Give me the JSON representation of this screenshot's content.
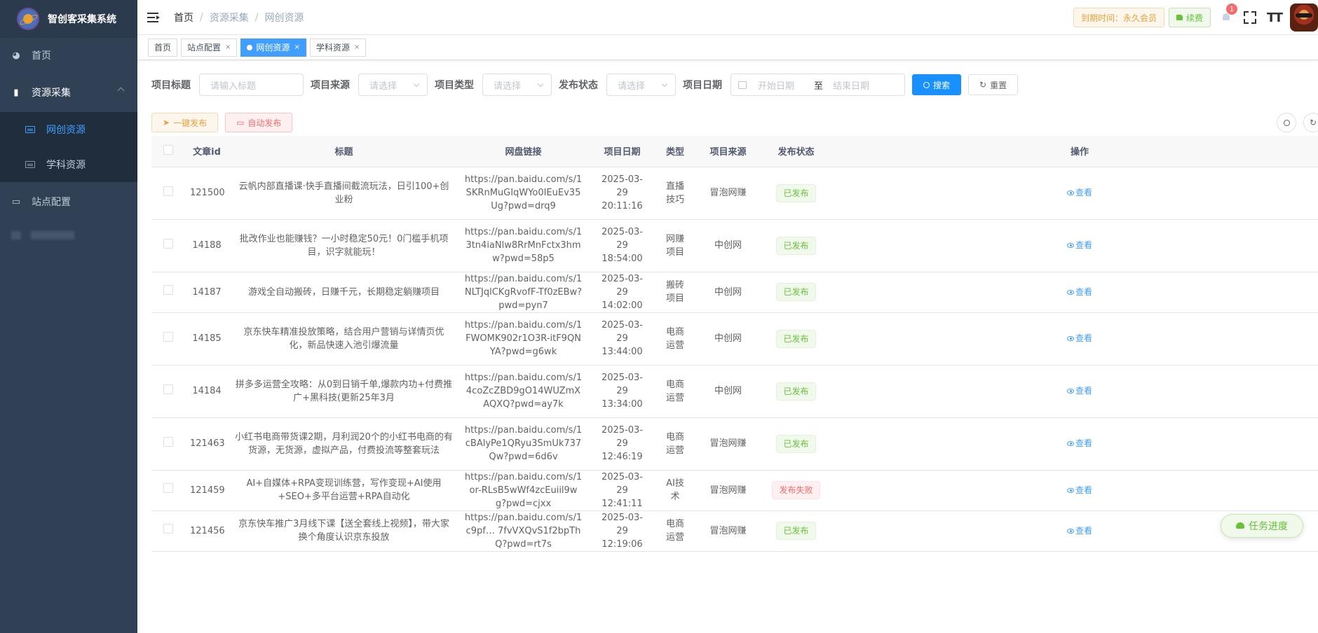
{
  "app": {
    "title": "智创客采集系统"
  },
  "sidebar": {
    "items": [
      {
        "label": "首页",
        "icon": "dashboard-icon"
      },
      {
        "label": "资源采集",
        "icon": "chart-icon"
      },
      {
        "label": "站点配置",
        "icon": "monitor-icon"
      }
    ],
    "sub_items": [
      {
        "label": "网创资源",
        "active": true
      },
      {
        "label": "学科资源",
        "active": false
      }
    ]
  },
  "header": {
    "breadcrumb": [
      "首页",
      "资源采集",
      "网创资源"
    ],
    "expire_label": "到期时间：永久会员",
    "renew_label": "续费",
    "notification_count": "1"
  },
  "tags": [
    {
      "label": "首页",
      "closable": false
    },
    {
      "label": "站点配置",
      "closable": true
    },
    {
      "label": "网创资源",
      "closable": true,
      "active": true
    },
    {
      "label": "学科资源",
      "closable": true
    }
  ],
  "tag_close": "×",
  "filters": {
    "title_label": "项目标题",
    "title_placeholder": "请输入标题",
    "source_label": "项目来源",
    "source_placeholder": "请选择",
    "type_label": "项目类型",
    "type_placeholder": "请选择",
    "status_label": "发布状态",
    "status_placeholder": "请选择",
    "date_label": "项目日期",
    "date_start": "开始日期",
    "date_to": "至",
    "date_end": "结束日期",
    "search_button": "搜索",
    "reset_button": "重置"
  },
  "toolbar": {
    "publish_all": "一键发布",
    "auto_publish": "自动发布"
  },
  "table": {
    "columns": [
      "文章id",
      "标题",
      "网盘链接",
      "项目日期",
      "类型",
      "项目来源",
      "发布状态",
      "操作"
    ],
    "action_label": "查看",
    "rows": [
      {
        "id": "121500",
        "title": "云帆内部直播课·快手直播间截流玩法，日引100+创业粉",
        "link": "https://pan.baidu.com/s/1SKRnMuGIqWYo0IEuEv35Ug?pwd=drq9",
        "date": "2025-03-29 20:11:16",
        "type": "直播技巧",
        "source": "冒泡网赚",
        "status": "已发布",
        "ok": true
      },
      {
        "id": "14188",
        "title": "批改作业也能赚钱？一小时稳定50元！0门槛手机项目，识字就能玩！",
        "link": "https://pan.baidu.com/s/13tn4iaNlw8RrMnFctx3hmw?pwd=58p5",
        "date": "2025-03-29 18:54:00",
        "type": "网赚项目",
        "source": "中创网",
        "status": "已发布",
        "ok": true
      },
      {
        "id": "14187",
        "title": "游戏全自动搬砖，日赚千元，长期稳定躺赚项目",
        "link": "https://pan.baidu.com/s/1NLTJqlCKgRvofF-Tf0zEBw?pwd=pyn7",
        "date": "2025-03-29 14:02:00",
        "type": "搬砖项目",
        "source": "中创网",
        "status": "已发布",
        "ok": true
      },
      {
        "id": "14185",
        "title": "京东快车精准投放策略，结合用户营销与详情页优化，新品快速入池引爆流量",
        "link": "https://pan.baidu.com/s/1FWOMK902r1O3R-itF9QNYA?pwd=g6wk",
        "date": "2025-03-29 13:44:00",
        "type": "电商运营",
        "source": "中创网",
        "status": "已发布",
        "ok": true
      },
      {
        "id": "14184",
        "title": "拼多多运营全攻略：从0到日销千单,爆款内功+付费推广+黑科技(更新25年3月",
        "link": "https://pan.baidu.com/s/14coZcZBD9gO14WUZmXAQXQ?pwd=ay7k",
        "date": "2025-03-29 13:34:00",
        "type": "电商运营",
        "source": "中创网",
        "status": "已发布",
        "ok": true
      },
      {
        "id": "121463",
        "title": "小红书电商带货课2期，月利润20个的小红书电商的有货源，无货源，虚拟产品，付费投流等整套玩法",
        "link": "https://pan.baidu.com/s/1cBAlyPe1QRyu3SmUk737Qw?pwd=6d6v",
        "date": "2025-03-29 12:46:19",
        "type": "电商运营",
        "source": "冒泡网赚",
        "status": "已发布",
        "ok": true
      },
      {
        "id": "121459",
        "title": "AI+自媒体+RPA变现训练营，写作变现+AI使用+SEO+多平台运营+RPA自动化",
        "link": "https://pan.baidu.com/s/1or-RLsB5wWf4zcEuiil9wg?pwd=cjxx",
        "date": "2025-03-29 12:41:11",
        "type": "AI技术",
        "source": "冒泡网赚",
        "status": "发布失败",
        "ok": false
      },
      {
        "id": "121456",
        "title": "京东快车推广3月线下课【送全套线上视频】，带大家换个角度认识京东投放",
        "link": "https://pan.baidu.com/s/1c9pf… 7fvVXQvS1f2bpThQ?pwd=rt7s",
        "date": "2025-03-29 12:19:06",
        "type": "电商运营",
        "source": "冒泡网赚",
        "status": "已发布",
        "ok": true
      }
    ]
  },
  "task_button": "任务进度",
  "colors": {
    "sidebar": "#304156",
    "primary": "#409eff",
    "success": "#67c23a",
    "danger": "#f56c6c",
    "warning": "#e6a23c"
  }
}
